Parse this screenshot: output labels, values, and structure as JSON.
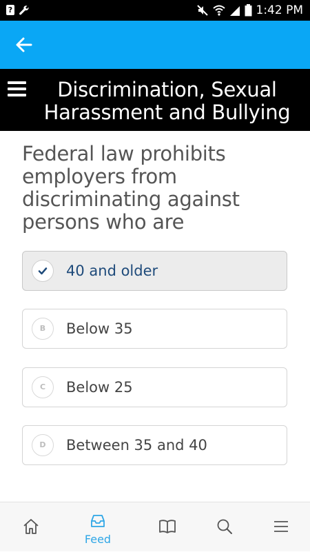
{
  "status_bar": {
    "left_icons": [
      "notification-box-icon",
      "wrench-icon"
    ],
    "right_icons": [
      "mute-icon",
      "wifi-icon",
      "signal-icon",
      "battery-icon"
    ],
    "notif_glyph": "?",
    "time": "1:42 PM"
  },
  "app_bar": {
    "back_icon": "arrow-left-icon",
    "color": "#0aa7f5"
  },
  "title_bar": {
    "menu_icon": "hamburger-menu-icon",
    "title_line1": "Discrimination, Sexual",
    "title_line2": "Harassment and Bullying"
  },
  "question": {
    "lines": [
      "Federal law prohibits",
      "employers from",
      "discriminating against",
      "persons who are"
    ]
  },
  "options": [
    {
      "letter": "",
      "label": "40 and older",
      "selected": true
    },
    {
      "letter": "B",
      "label": "Below 35",
      "selected": false
    },
    {
      "letter": "C",
      "label": "Below 25",
      "selected": false
    },
    {
      "letter": "D",
      "label": "Between 35 and 40",
      "selected": false
    }
  ],
  "bottom_nav": {
    "items": [
      {
        "icon": "home-icon",
        "label": ""
      },
      {
        "icon": "inbox-tray-icon",
        "label": "Feed",
        "active": true
      },
      {
        "icon": "book-icon",
        "label": ""
      },
      {
        "icon": "search-icon",
        "label": ""
      },
      {
        "icon": "menu-lines-icon",
        "label": ""
      }
    ],
    "active_color": "#2ea6e6",
    "inactive_color": "#555555"
  }
}
